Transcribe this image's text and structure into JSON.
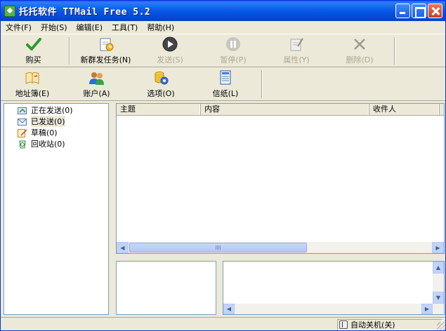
{
  "window": {
    "title": "托托软件 TTMail Free 5.2"
  },
  "menu": [
    {
      "label": "文件(F)"
    },
    {
      "label": "开始(S)"
    },
    {
      "label": "编辑(E)"
    },
    {
      "label": "工具(T)"
    },
    {
      "label": "帮助(H)"
    }
  ],
  "toolbar1": {
    "buy": "购买",
    "new_task": "新群发任务(N)",
    "send": "发送(S)",
    "pause": "暂停(P)",
    "properties": "属性(Y)",
    "delete": "删除(D)"
  },
  "toolbar2": {
    "address_book": "地址簿(E)",
    "account": "账户(A)",
    "options": "选项(O)",
    "letterhead": "信纸(L)"
  },
  "tree": [
    {
      "label": "正在发送(0)",
      "icon": "sending-folder-icon"
    },
    {
      "label": "已发送(0)",
      "icon": "sent-folder-icon"
    },
    {
      "label": "草稿(0)",
      "icon": "drafts-folder-icon"
    },
    {
      "label": "回收站(0)",
      "icon": "recycle-bin-icon"
    }
  ],
  "mail_list": {
    "columns": [
      "主题",
      "内容",
      "收件人"
    ],
    "rows": []
  },
  "status": {
    "auto_shutdown": "自动关机(关)"
  },
  "colors": {
    "titlebar": "#0553e0",
    "window_bg": "#ece9d8",
    "border": "#7f9db9"
  }
}
